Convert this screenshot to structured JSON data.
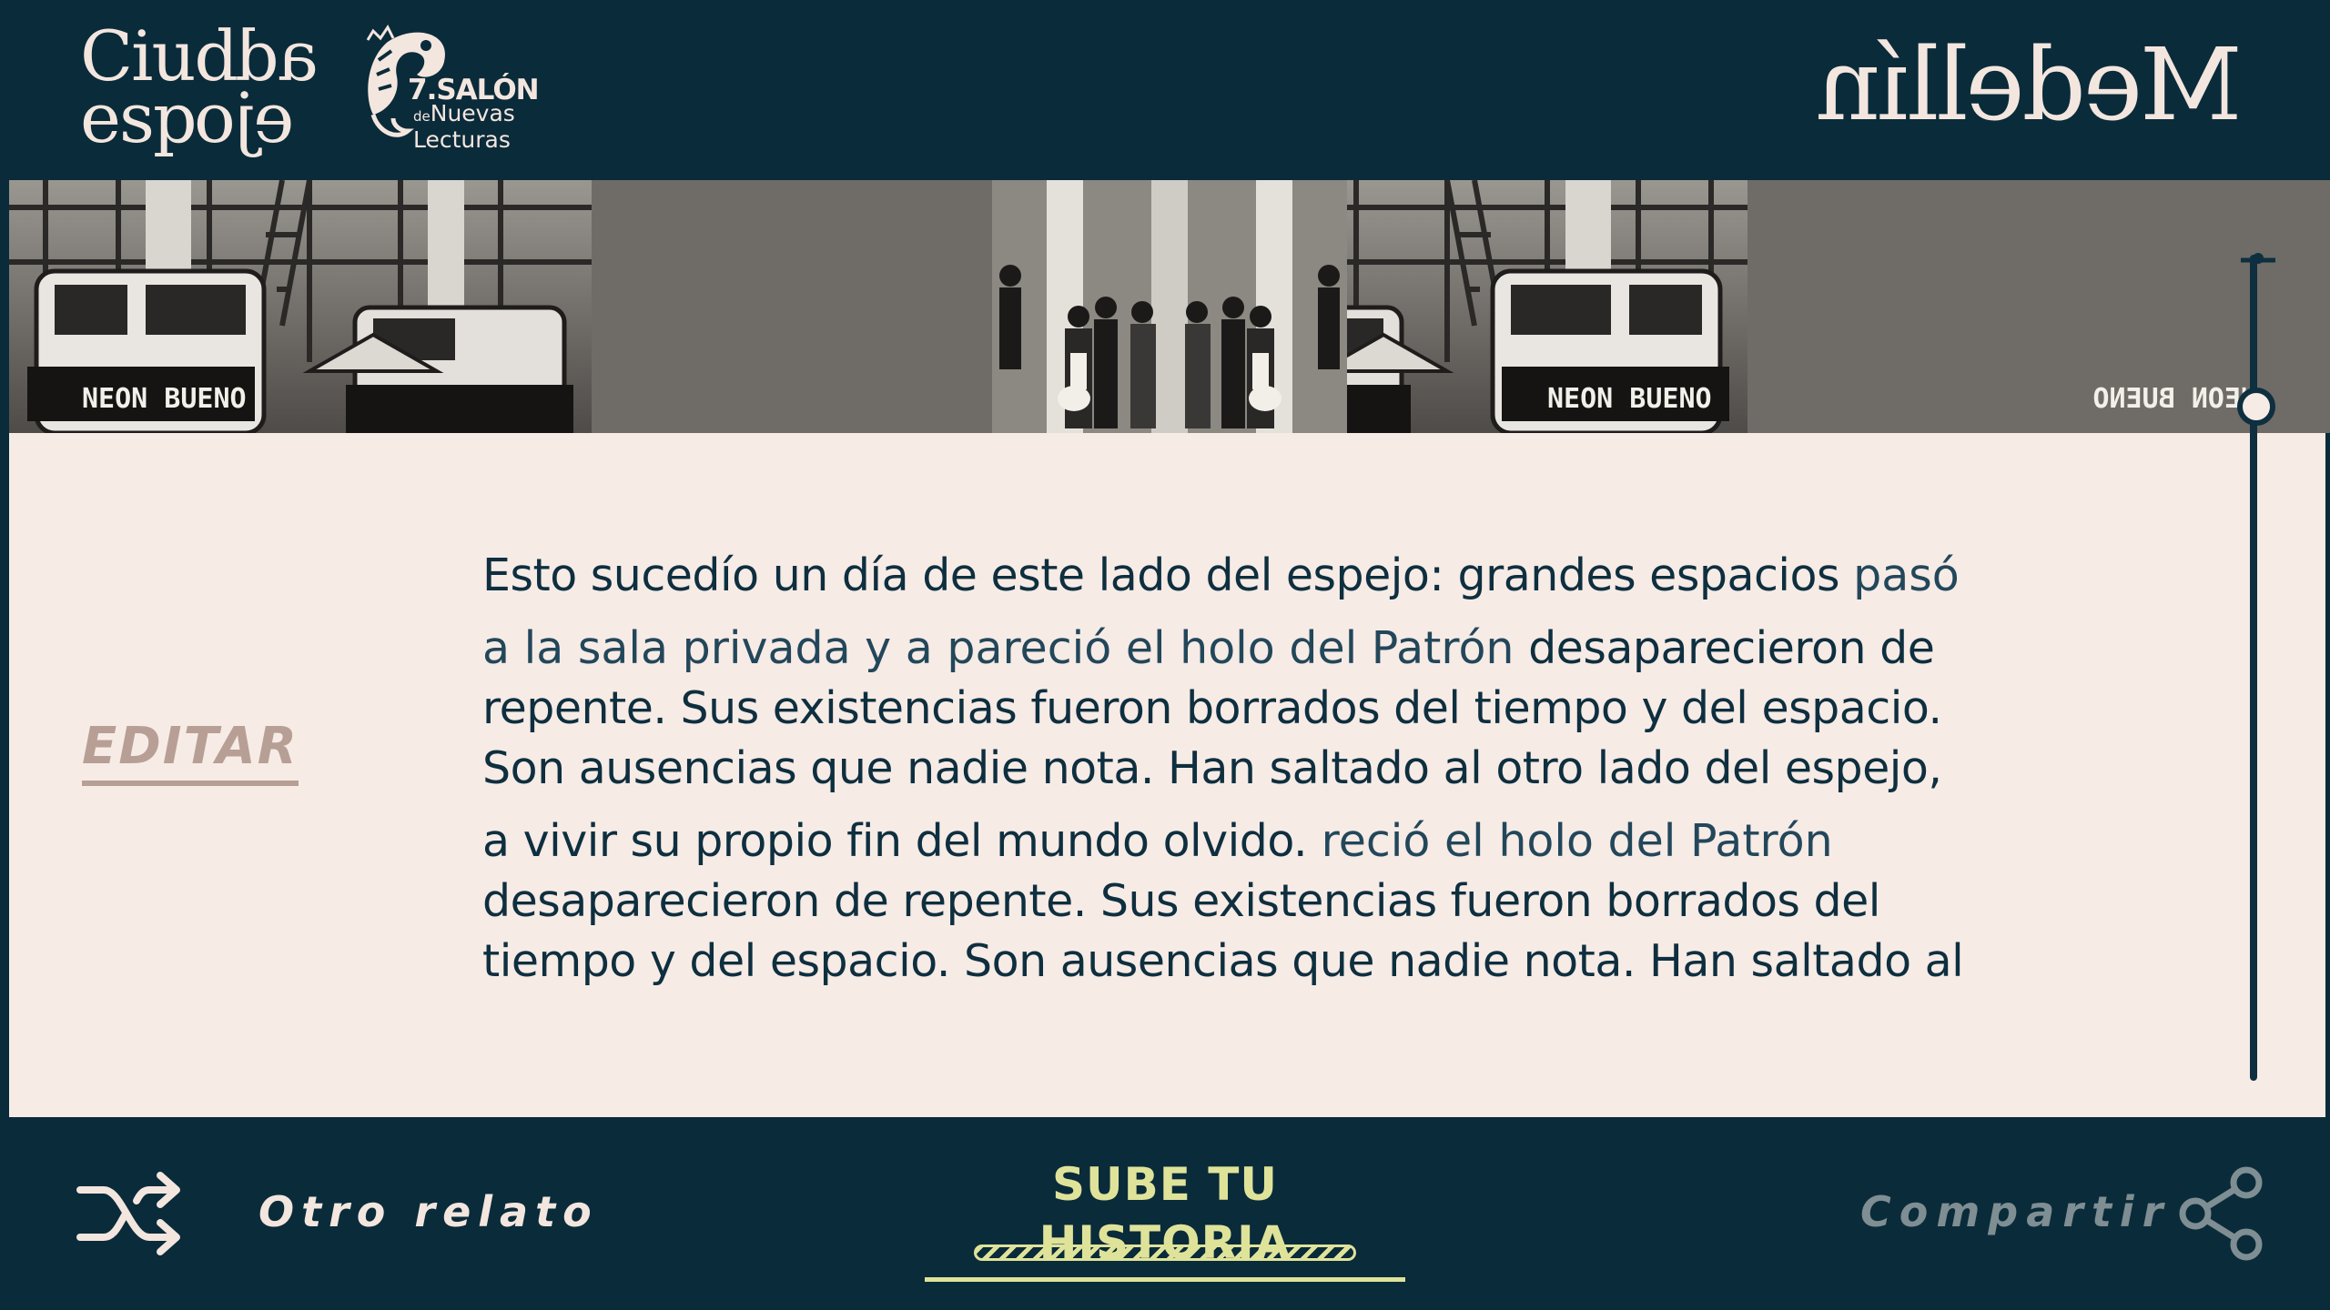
{
  "header": {
    "logo_left_line1": "Ciud",
    "logo_left_line1_flip": "ad",
    "logo_left_line2": "esp",
    "logo_left_line2_flip": "ejo",
    "salon_number": "7.",
    "salon_title": "SALÓN",
    "salon_de": "de",
    "salon_line2": "Nuevas",
    "salon_line3": "Lecturas",
    "logo_right": "Medellín"
  },
  "banner": {
    "sign_text": "NEON BUENO"
  },
  "story": {
    "edit_label": "EDITAR",
    "lines": [
      {
        "strong": "Esto sucedío  un día de este lado del espejo: grandes espacios ",
        "light": " pasó"
      },
      {
        "strong": "",
        "light": "a la sala privada y a pareció el holo del Patrón ",
        "strong2": " desaparecieron de"
      },
      {
        "strong": "repente. Sus existencias fueron borrados del tiempo y del espacio."
      },
      {
        "strong": "Son ausencias que nadie nota. Han saltado al otro lado del espejo,"
      },
      {
        "strong": "a vivir su propio fin del mundo olvido.",
        "light": " reció el holo del Patrón"
      },
      {
        "strong": "desaparecieron de repente. Sus existencias fueron borrados del"
      },
      {
        "strong": "tiempo y del espacio. Son ausencias que nadie nota. Han saltado al"
      }
    ]
  },
  "footer": {
    "shuffle_icon": "shuffle-icon",
    "other_story_label": "Otro relato",
    "upload_label": "SUBE TU HISTORIA",
    "share_label": "Compartir",
    "share_icon": "share-icon"
  },
  "colors": {
    "background": "#0a2b3a",
    "panel": "#f7ebe6",
    "text": "#0e2f3f",
    "edit": "#b79f96",
    "accent": "#dfe39a",
    "muted": "#7e8e93"
  }
}
